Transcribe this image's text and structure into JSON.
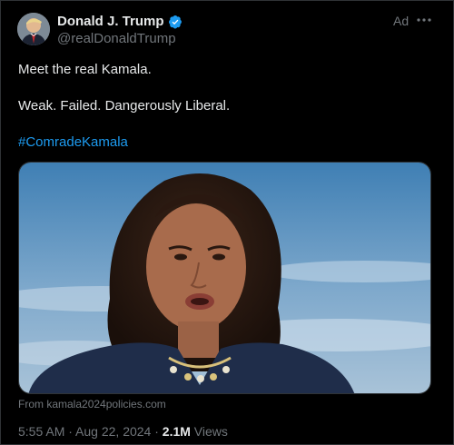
{
  "author": {
    "display_name": "Donald J. Trump",
    "handle": "@realDonaldTrump",
    "verified": true
  },
  "ad_label": "Ad",
  "tweet": {
    "line1": "Meet the real Kamala.",
    "line2": "Weak. Failed. Dangerously Liberal.",
    "hashtag": "#ComradeKamala"
  },
  "media": {
    "source_text": "From kamala2024policies.com"
  },
  "meta": {
    "time": "5:55 AM",
    "separator1": " · ",
    "date": "Aug 22, 2024",
    "separator2": " · ",
    "views_count": "2.1M",
    "views_label": " Views"
  },
  "icons": {
    "verified": "verified-badge-icon",
    "more": "more-options-icon"
  },
  "colors": {
    "background": "#000000",
    "text": "#e7e9ea",
    "secondary": "#71767b",
    "accent": "#1d9bf0"
  }
}
